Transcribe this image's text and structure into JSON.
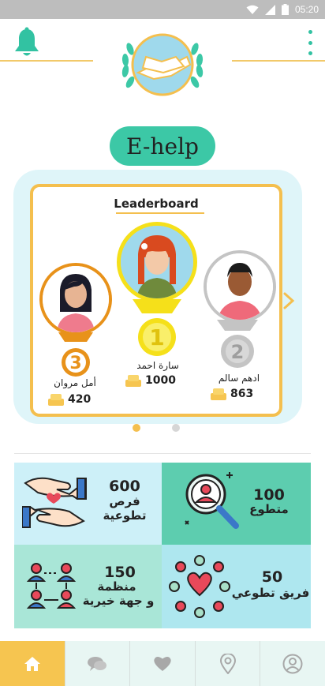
{
  "status_bar": {
    "time": "05:20"
  },
  "header": {
    "app_name": "E-help"
  },
  "leaderboard": {
    "title": "Leaderboard",
    "entries": [
      {
        "rank": "1",
        "name": "سارة احمد",
        "points": "1000"
      },
      {
        "rank": "2",
        "name": "ادهم سالم",
        "points": "863"
      },
      {
        "rank": "3",
        "name": "أمل مروان",
        "points": "420"
      }
    ],
    "page_index": 1,
    "page_count": 2
  },
  "stats": [
    {
      "number": "600",
      "text_line1": "فرص",
      "text_line2": "تطوعية",
      "icon": "helping-hands-icon"
    },
    {
      "number": "100",
      "text_line1": "متطوع",
      "text_line2": "",
      "icon": "volunteer-search-icon"
    },
    {
      "number": "150",
      "text_line1": "منظمة",
      "text_line2": "و جهة خيرية",
      "icon": "organization-network-icon"
    },
    {
      "number": "50",
      "text_line1": "فريق تطوعي",
      "text_line2": "",
      "icon": "team-circle-icon"
    }
  ],
  "nav": [
    {
      "name": "home",
      "icon": "home-icon",
      "active": true
    },
    {
      "name": "chat",
      "icon": "chat-icon",
      "active": false
    },
    {
      "name": "favorites",
      "icon": "heart-icon",
      "active": false
    },
    {
      "name": "location",
      "icon": "location-icon",
      "active": false
    },
    {
      "name": "profile",
      "icon": "profile-icon",
      "active": false
    }
  ],
  "colors": {
    "primary": "#3cc8a6",
    "accent_gold": "#f4bf4e",
    "nav_active": "#f6c550",
    "card_light_blue": "#cdf0f8",
    "card_green": "#5dcdaf",
    "card_mint": "#a9e6d7",
    "card_aqua": "#aee7ef"
  }
}
